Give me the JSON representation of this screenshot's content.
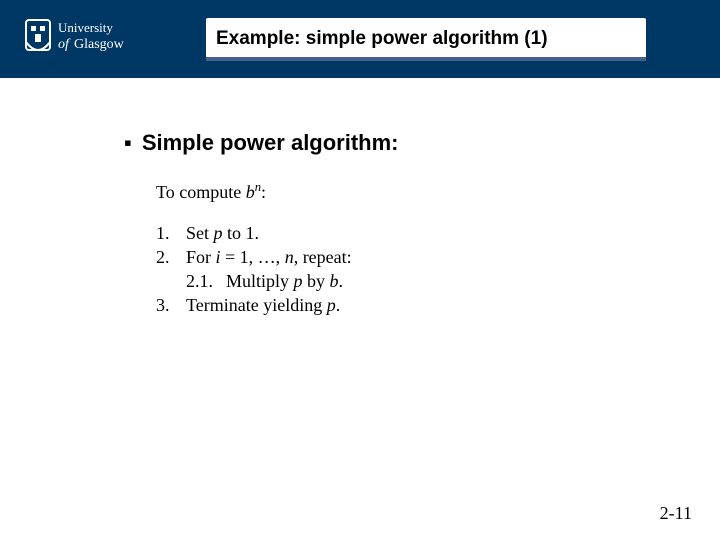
{
  "header": {
    "logo_institution": "University of Glasgow",
    "title": "Example: simple power algorithm (1)"
  },
  "content": {
    "heading": "Simple power algorithm:",
    "compute_prefix": "To compute ",
    "compute_base": "b",
    "compute_exp": "n",
    "compute_suffix": ":",
    "steps": {
      "s1_num": "1.",
      "s1_a": "Set ",
      "s1_p": "p",
      "s1_b": " to 1.",
      "s2_num": "2.",
      "s2_a": "For ",
      "s2_i": "i",
      "s2_b": " = 1, …, ",
      "s2_n": "n",
      "s2_c": ", repeat:",
      "s21_num": "2.1.",
      "s21_a": "Multiply ",
      "s21_p": "p",
      "s21_b": " by ",
      "s21_c": "b",
      "s21_d": ".",
      "s3_num": "3.",
      "s3_a": "Terminate yielding ",
      "s3_p": "p",
      "s3_b": "."
    }
  },
  "footer": {
    "page_number": "2-11"
  }
}
